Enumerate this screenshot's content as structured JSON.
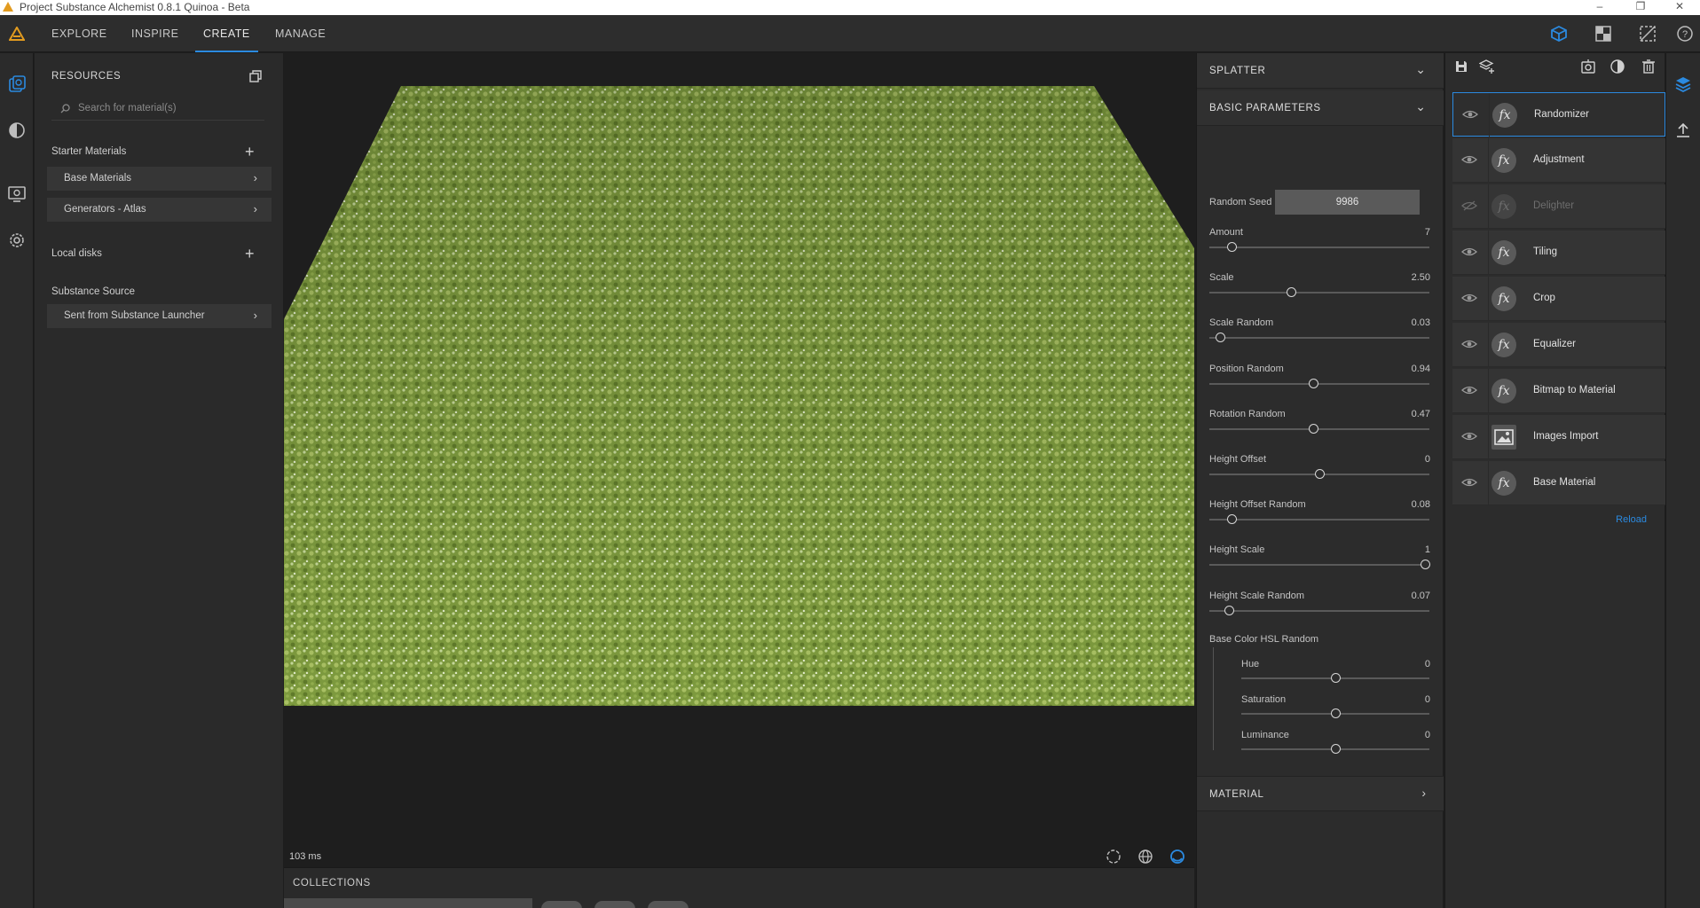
{
  "window": {
    "title": "Project Substance Alchemist 0.8.1 Quinoa - Beta",
    "controls": [
      "–",
      "❐",
      "✕"
    ]
  },
  "menu": {
    "tabs": [
      "EXPLORE",
      "INSPIRE",
      "CREATE",
      "MANAGE"
    ],
    "active": "CREATE"
  },
  "resources": {
    "title": "RESOURCES",
    "search_placeholder": "Search for material(s)",
    "starter_label": "Starter Materials",
    "starter_items": [
      "Base Materials",
      "Generators - Atlas"
    ],
    "local_label": "Local disks",
    "source_label": "Substance Source",
    "source_items": [
      "Sent from Substance Launcher"
    ]
  },
  "viewport": {
    "timing": "103 ms"
  },
  "collections": {
    "title": "COLLECTIONS"
  },
  "properties": {
    "splatter_title": "SPLATTER",
    "basic_title": "BASIC PARAMETERS",
    "seed_label": "Random Seed",
    "seed_value": "9986",
    "params": [
      {
        "label": "Amount",
        "value": "7",
        "fraction": 0.1
      },
      {
        "label": "Scale",
        "value": "2.50",
        "fraction": 0.37
      },
      {
        "label": "Scale Random",
        "value": "0.03",
        "fraction": 0.05
      },
      {
        "label": "Position Random",
        "value": "0.94",
        "fraction": 0.47
      },
      {
        "label": "Rotation Random",
        "value": "0.47",
        "fraction": 0.47
      },
      {
        "label": "Height Offset",
        "value": "0",
        "fraction": 0.5
      },
      {
        "label": "Height Offset Random",
        "value": "0.08",
        "fraction": 0.1
      },
      {
        "label": "Height Scale",
        "value": "1",
        "fraction": 0.98
      },
      {
        "label": "Height Scale Random",
        "value": "0.07",
        "fraction": 0.09
      }
    ],
    "hsl_label": "Base Color HSL Random",
    "hsl_params": [
      {
        "label": "Hue",
        "value": "0",
        "fraction": 0.5
      },
      {
        "label": "Saturation",
        "value": "0",
        "fraction": 0.5
      },
      {
        "label": "Luminance",
        "value": "0",
        "fraction": 0.5
      }
    ],
    "material_title": "MATERIAL"
  },
  "layers": {
    "items": [
      {
        "name": "Randomizer",
        "icon": "fx-icon",
        "visible": true,
        "selected": true
      },
      {
        "name": "Adjustment",
        "icon": "fx-icon",
        "visible": true
      },
      {
        "name": "Delighter",
        "icon": "fx-icon",
        "visible": false
      },
      {
        "name": "Tiling",
        "icon": "fx-icon",
        "visible": true
      },
      {
        "name": "Crop",
        "icon": "fx-icon",
        "visible": true
      },
      {
        "name": "Equalizer",
        "icon": "fx-icon",
        "visible": true
      },
      {
        "name": "Bitmap to Material",
        "icon": "fx-icon",
        "visible": true
      },
      {
        "name": "Images Import",
        "icon": "image-icon",
        "visible": true
      },
      {
        "name": "Base Material",
        "icon": "fx-icon",
        "visible": true
      }
    ],
    "reload_label": "Reload"
  },
  "colors": {
    "accent": "#2b8ae0",
    "grass_base": "#7d9a3e",
    "grass_light": "#a9c063"
  }
}
